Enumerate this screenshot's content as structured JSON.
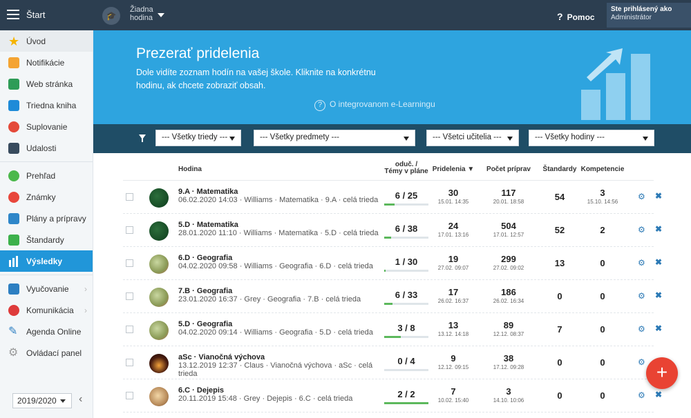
{
  "topbar": {
    "start_label": "Štart",
    "lesson_label": "Žiadna hodina",
    "help_q": "?",
    "help_label": "Pomoc",
    "user_line1": "Ste prihlásený ako",
    "user_line2": "Administrátor"
  },
  "sidebar": {
    "items": [
      {
        "label": "Úvod",
        "icon": "star-icon"
      },
      {
        "label": "Notifikácie",
        "icon": "envelope-icon"
      },
      {
        "label": "Web stránka",
        "icon": "home-icon"
      },
      {
        "label": "Triedna kniha",
        "icon": "book-icon"
      },
      {
        "label": "Suplovanie",
        "icon": "person-icon"
      },
      {
        "label": "Udalosti",
        "icon": "calendar-icon"
      },
      {
        "label": "Prehľad",
        "icon": "check-circle-icon"
      },
      {
        "label": "Známky",
        "icon": "grade-icon"
      },
      {
        "label": "Plány a prípravy",
        "icon": "briefcase-icon"
      },
      {
        "label": "Štandardy",
        "icon": "shield-icon"
      },
      {
        "label": "Výsledky",
        "icon": "bar-chart-icon"
      },
      {
        "label": "Vyučovanie",
        "icon": "open-book-icon"
      },
      {
        "label": "Komunikácia",
        "icon": "chat-icon"
      },
      {
        "label": "Agenda Online",
        "icon": "pen-icon"
      },
      {
        "label": "Ovládací panel",
        "icon": "gear-icon"
      }
    ],
    "year": "2019/2020"
  },
  "hero": {
    "title": "Prezerať pridelenia",
    "description": "Dole vidíte zoznam hodín na vašej škole. Kliknite na konkrétnu hodinu, ak chcete zobraziť obsah.",
    "elearning_link": "O integrovanom e-Learningu"
  },
  "filters": {
    "classes": "--- Všetky triedy ---",
    "subjects": "--- Všetky predmety ---",
    "teachers": "--- Všetci učitelia ---",
    "lessons": "--- Všetky hodiny ---"
  },
  "table": {
    "headers": {
      "hodina": "Hodina",
      "taught_l1": "oduč. /",
      "taught_l2": "Témy v pláne",
      "assignments": "Pridelenia ▼",
      "preparations": "Počet príprav",
      "standards": "Štandardy",
      "competences": "Kompetencie"
    },
    "rows": [
      {
        "name": "9.A · Matematika",
        "sub": "06.02.2020 14:03 · Williams · Matematika · 9.A · celá trieda",
        "ratio": "6 / 25",
        "progress": 0.24,
        "assign": "30",
        "assign_date": "15.01. 14:35",
        "prep": "117",
        "prep_date": "20.01. 18:58",
        "std": "54",
        "comp": "3",
        "comp_date": "15.10. 14:56",
        "img": "green"
      },
      {
        "name": "5.D · Matematika",
        "sub": "28.01.2020 11:10 · Williams · Matematika · 5.D · celá trieda",
        "ratio": "6 / 38",
        "progress": 0.16,
        "assign": "24",
        "assign_date": "17.01. 13:16",
        "prep": "504",
        "prep_date": "17.01. 12:57",
        "std": "52",
        "comp": "2",
        "comp_date": "",
        "img": "green"
      },
      {
        "name": "6.D · Geografia",
        "sub": "04.02.2020 09:58 · Williams · Geografia · 6.D · celá trieda",
        "ratio": "1 / 30",
        "progress": 0.03,
        "assign": "19",
        "assign_date": "27.02. 09:07",
        "prep": "299",
        "prep_date": "27.02. 09:02",
        "std": "13",
        "comp": "0",
        "comp_date": "",
        "img": "geo"
      },
      {
        "name": "7.B · Geografia",
        "sub": "23.01.2020 16:37 · Grey · Geografia · 7.B · celá trieda",
        "ratio": "6 / 33",
        "progress": 0.18,
        "assign": "17",
        "assign_date": "26.02. 16:37",
        "prep": "186",
        "prep_date": "26.02. 16:34",
        "std": "0",
        "comp": "0",
        "comp_date": "",
        "img": "geo"
      },
      {
        "name": "5.D · Geografia",
        "sub": "04.02.2020 09:14 · Williams · Geografia · 5.D · celá trieda",
        "ratio": "3 / 8",
        "progress": 0.375,
        "assign": "13",
        "assign_date": "13.12. 14:18",
        "prep": "89",
        "prep_date": "12.12. 08:37",
        "std": "7",
        "comp": "0",
        "comp_date": "",
        "img": "geo"
      },
      {
        "name": "aSc · Vianočná výchova",
        "sub": "13.12.2019 12:37 · Claus · Vianočná výchova · aSc · celá trieda",
        "ratio": "0 / 4",
        "progress": 0,
        "assign": "9",
        "assign_date": "12.12. 09:15",
        "prep": "38",
        "prep_date": "17.12. 09:28",
        "std": "0",
        "comp": "0",
        "comp_date": "",
        "img": "xmas"
      },
      {
        "name": "6.C · Dejepis",
        "sub": "20.11.2019 15:48 · Grey · Dejepis · 6.C · celá trieda",
        "ratio": "2 / 2",
        "progress": 1.0,
        "assign": "7",
        "assign_date": "10.02. 15:40",
        "prep": "3",
        "prep_date": "14.10. 10:06",
        "std": "0",
        "comp": "0",
        "comp_date": "",
        "img": "hist"
      }
    ]
  },
  "fab_label": "+"
}
